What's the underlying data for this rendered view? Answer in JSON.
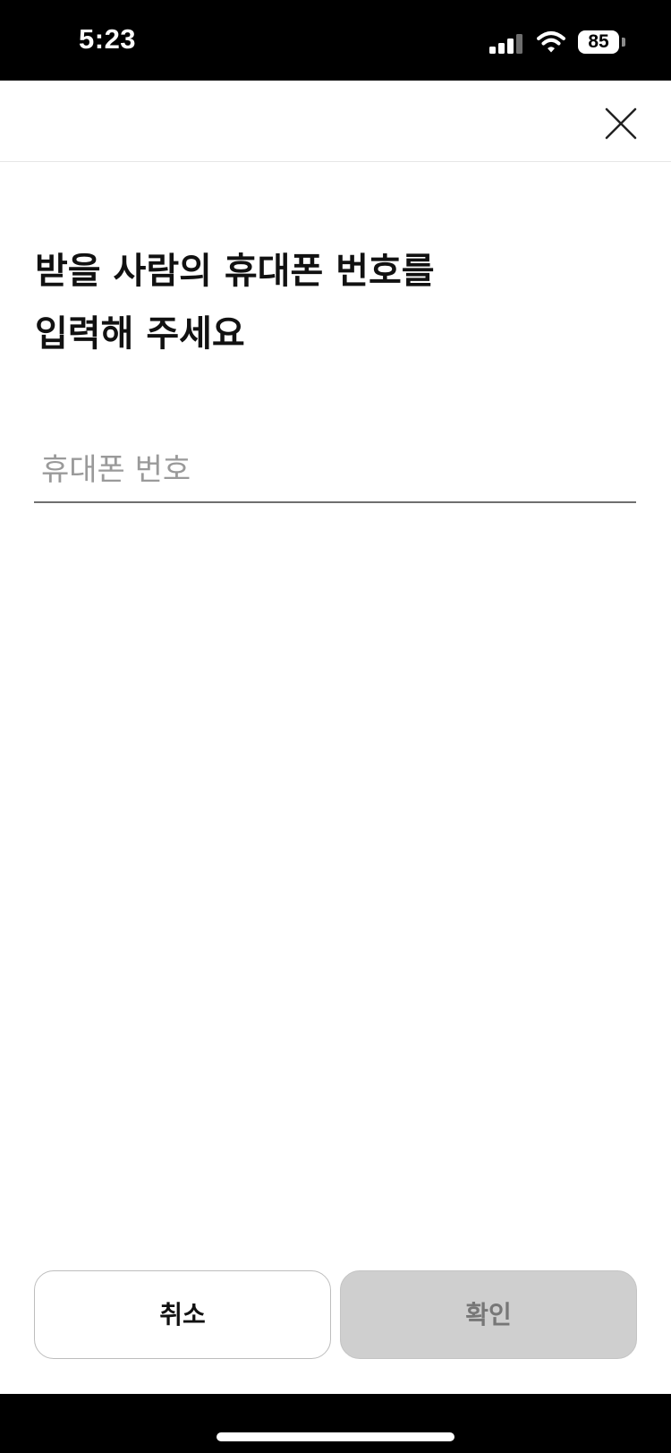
{
  "status_bar": {
    "time": "5:23",
    "battery_level": "85",
    "icons": [
      "signal-icon",
      "wifi-icon",
      "battery-icon"
    ]
  },
  "header": {
    "close_icon": "close-icon"
  },
  "title": {
    "line1": "받을 사람의 휴대폰 번호를",
    "line2": "입력해 주세요"
  },
  "phone_input": {
    "placeholder": "휴대폰 번호",
    "value": ""
  },
  "buttons": {
    "cancel_label": "취소",
    "confirm_label": "확인"
  },
  "colors": {
    "status_bar_bg": "#000000",
    "text_primary": "#111111",
    "placeholder": "#9a9a9a",
    "confirm_disabled_bg": "#cfcfcf",
    "cancel_border": "#bdbdbd"
  }
}
